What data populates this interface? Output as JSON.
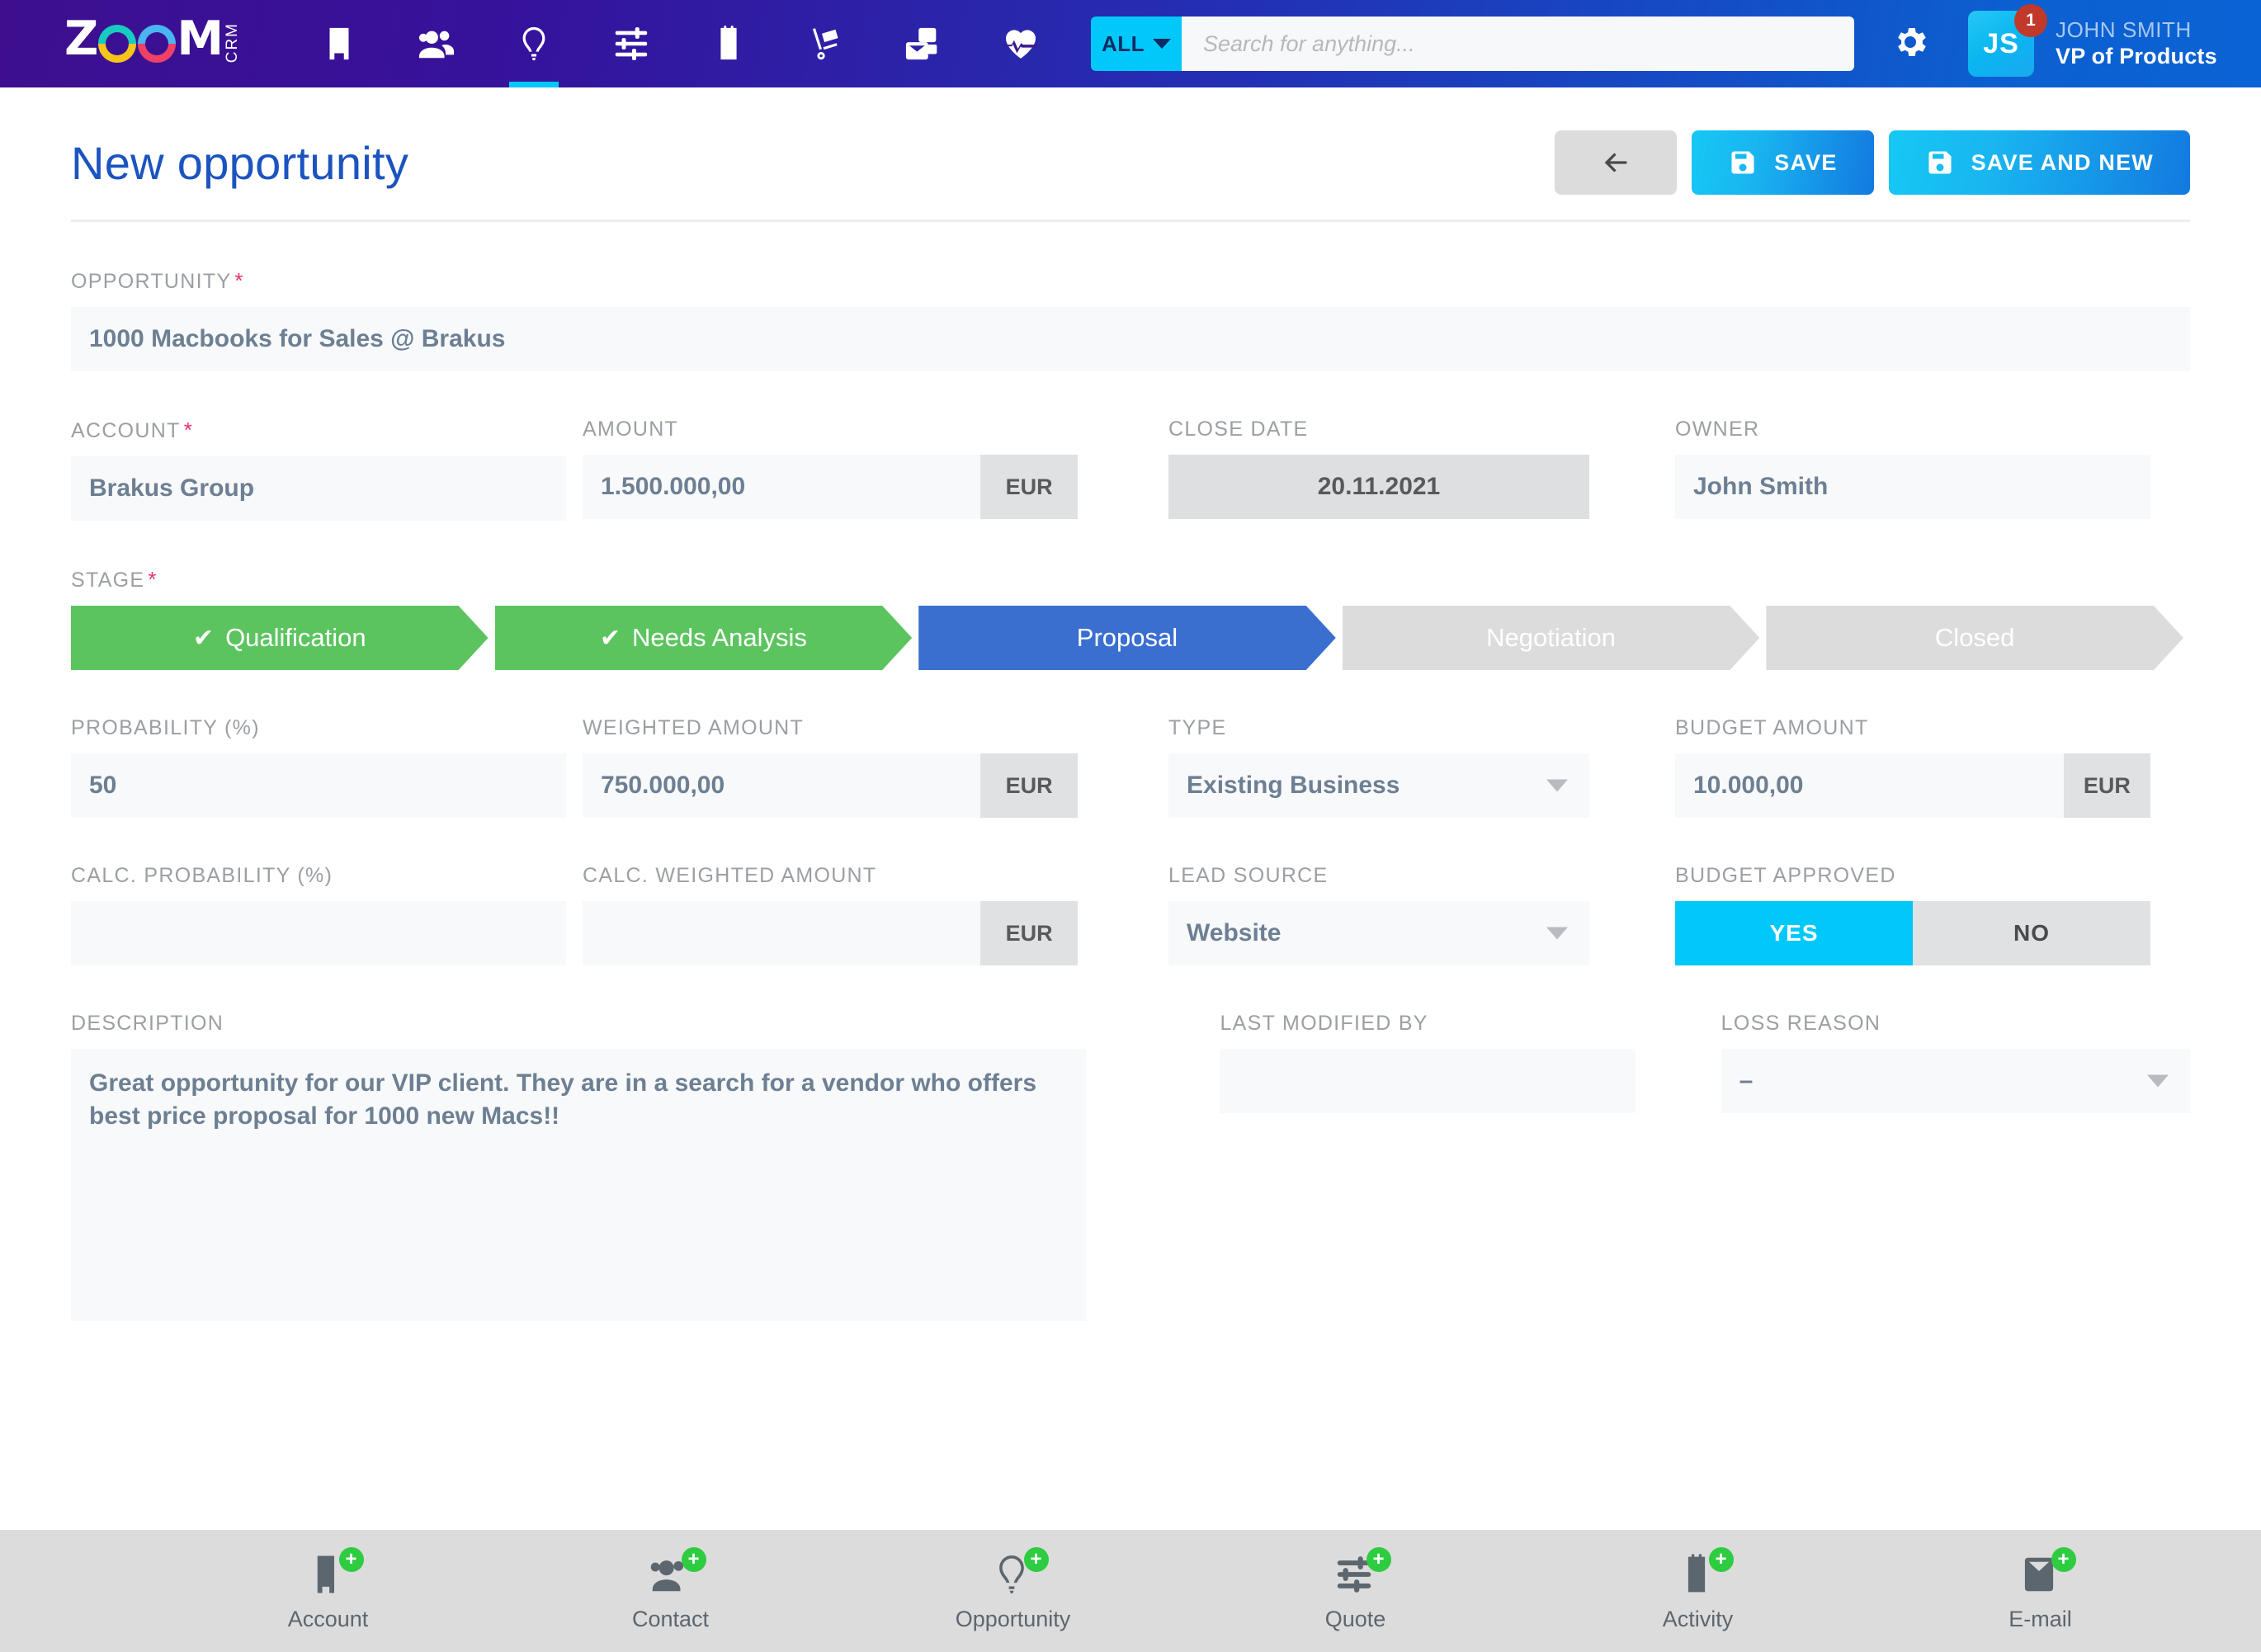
{
  "topbar": {
    "logo": {
      "text_left": "Z",
      "text_right": "M",
      "sub": "CRM"
    },
    "nav_items": [
      {
        "name": "building-icon",
        "label": "Accounts",
        "active": false
      },
      {
        "name": "people-icon",
        "label": "Contacts",
        "active": false
      },
      {
        "name": "lightbulb-icon",
        "label": "Opportunities",
        "active": true
      },
      {
        "name": "sliders-icon",
        "label": "Quotes",
        "active": false
      },
      {
        "name": "calendar-device-icon",
        "label": "Activities",
        "active": false
      },
      {
        "name": "hand-truck-icon",
        "label": "Orders",
        "active": false
      },
      {
        "name": "mail-stack-icon",
        "label": "E-mails",
        "active": false
      },
      {
        "name": "heartbeat-icon",
        "label": "Analytics",
        "active": false
      }
    ],
    "search_scope": "ALL",
    "search_placeholder": "Search for anything...",
    "gear_label": "Settings",
    "user": {
      "initials": "JS",
      "notification_count": "1",
      "name": "JOHN SMITH",
      "role": "VP of Products"
    }
  },
  "header": {
    "title": "New opportunity",
    "back_label": "Back",
    "save_label": "SAVE",
    "save_and_new_label": "SAVE AND NEW"
  },
  "form": {
    "opportunity": {
      "label": "OPPORTUNITY",
      "required": true,
      "value": "1000 Macbooks for Sales @ Brakus"
    },
    "account": {
      "label": "ACCOUNT",
      "required": true,
      "value": "Brakus Group"
    },
    "amount": {
      "label": "AMOUNT",
      "value": "1.500.000,00",
      "unit": "EUR"
    },
    "close_date": {
      "label": "CLOSE DATE",
      "value": "20.11.2021"
    },
    "owner": {
      "label": "OWNER",
      "value": "John Smith"
    },
    "stage": {
      "label": "STAGE",
      "required": true,
      "steps": [
        {
          "label": "Qualification",
          "state": "done",
          "check": "✔"
        },
        {
          "label": "Needs Analysis",
          "state": "done",
          "check": "✔"
        },
        {
          "label": "Proposal",
          "state": "current",
          "check": ""
        },
        {
          "label": "Negotiation",
          "state": "todo",
          "check": ""
        },
        {
          "label": "Closed",
          "state": "todo",
          "check": ""
        }
      ]
    },
    "probability": {
      "label": "PROBABILITY (%)",
      "value": "50"
    },
    "weighted_amount": {
      "label": "WEIGHTED AMOUNT",
      "value": "750.000,00",
      "unit": "EUR"
    },
    "type": {
      "label": "TYPE",
      "value": "Existing Business"
    },
    "budget_amount": {
      "label": "BUDGET AMOUNT",
      "value": "10.000,00",
      "unit": "EUR"
    },
    "calc_probability": {
      "label": "CALC. PROBABILITY (%)",
      "value": ""
    },
    "calc_weighted_amount": {
      "label": "CALC. WEIGHTED AMOUNT",
      "value": "",
      "unit": "EUR"
    },
    "lead_source": {
      "label": "LEAD SOURCE",
      "value": "Website"
    },
    "budget_approved": {
      "label": "BUDGET APPROVED",
      "yes_label": "YES",
      "no_label": "NO",
      "selected": "YES"
    },
    "description": {
      "label": "DESCRIPTION",
      "value": "Great opportunity for our VIP client. They are in a search for a vendor who offers best price proposal for 1000 new Macs!!"
    },
    "last_modified_by": {
      "label": "LAST MODIFIED BY",
      "value": ""
    },
    "loss_reason": {
      "label": "LOSS REASON",
      "value": "–"
    }
  },
  "bottombar": {
    "items": [
      {
        "icon": "building-icon",
        "label": "Account"
      },
      {
        "icon": "people-icon",
        "label": "Contact"
      },
      {
        "icon": "lightbulb-icon",
        "label": "Opportunity"
      },
      {
        "icon": "sliders-icon",
        "label": "Quote"
      },
      {
        "icon": "calendar-device-icon",
        "label": "Activity"
      },
      {
        "icon": "envelope-icon",
        "label": "E-mail"
      }
    ],
    "add_glyph": "+"
  },
  "colors": {
    "brand_purple": "#3d0f8f",
    "brand_blue": "#0a63d4",
    "accent_cyan": "#00c8f8",
    "stage_done": "#5cc45f",
    "stage_current": "#3a6fd0",
    "stage_todo": "#dcdcdc",
    "required_pink": "#e8316f",
    "title_blue": "#1b54bf"
  }
}
